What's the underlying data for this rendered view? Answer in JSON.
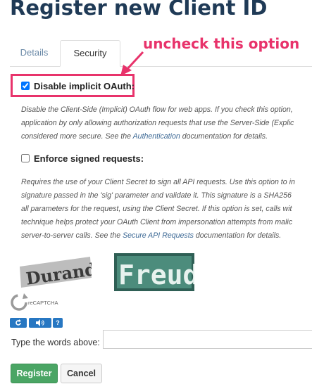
{
  "page": {
    "title": "Register new Client ID"
  },
  "tabs": [
    {
      "label": "Details"
    },
    {
      "label": "Security"
    }
  ],
  "annotation": {
    "text": "uncheck this option",
    "color": "#e8336b"
  },
  "options": {
    "implicit_oauth": {
      "label": "Disable implicit OAuth:",
      "checked": true,
      "desc_lines": [
        "Disable the Client-Side (Implicit) OAuth flow for web apps. If you check this option,",
        "application by only allowing authorization requests that use the Server-Side (Explic",
        "considered more secure. See the "
      ],
      "desc_link": "Authentication",
      "desc_tail": " documentation for details."
    },
    "signed_requests": {
      "label": "Enforce signed requests:",
      "checked": false,
      "desc_lines": [
        "Requires the use of your Client Secret to sign all API requests. Use this option to in",
        "signature passed in the 'sig' parameter and validate it. This signature is a SHA256",
        "all parameters for the request, using the Client Secret. If this option is set, calls wit",
        "technique helps protect your OAuth Client from impersonation attempts from malic",
        "server-to-server calls. See the "
      ],
      "desc_link": "Secure API Requests",
      "desc_tail": " documentation for details."
    }
  },
  "captcha": {
    "word1": "Durand",
    "word2": "Freud",
    "brand": "reCAPTCHA",
    "buttons": [
      {
        "icon": "refresh-icon"
      },
      {
        "icon": "audio-icon"
      },
      {
        "icon": "help-icon",
        "label": "?"
      }
    ],
    "prompt": "Type the words above:",
    "input_value": ""
  },
  "actions": {
    "register": "Register",
    "cancel": "Cancel"
  },
  "colors": {
    "title": "#1f3a56",
    "link": "#3e6a96",
    "register_bg": "#4aa564",
    "captcha_btn": "#2777c2"
  }
}
